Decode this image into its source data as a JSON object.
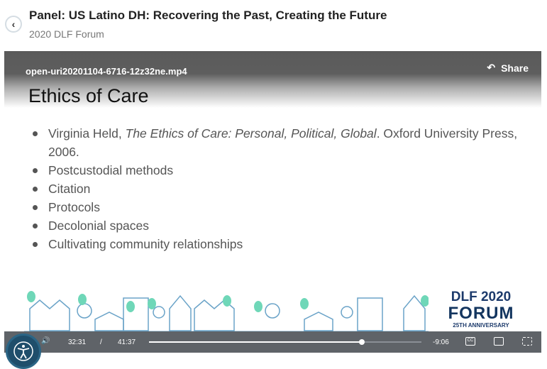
{
  "header": {
    "title": "Panel: US Latino DH: Recovering the Past, Creating the Future",
    "subtitle": "2020 DLF Forum",
    "back_icon": "chevron-left-icon"
  },
  "video": {
    "filename": "open-uri20201104-6716-12z32ne.mp4",
    "share_label": "Share",
    "slide": {
      "title": "Ethics of Care",
      "bullets": [
        {
          "pre": "Virginia Held, ",
          "italic": "The Ethics of Care: Personal, Political, Global",
          "post": ". Oxford University Press, 2006."
        },
        {
          "pre": "Postcustodial methods"
        },
        {
          "pre": "Citation"
        },
        {
          "pre": "Protocols"
        },
        {
          "pre": "Decolonial spaces"
        },
        {
          "pre": "Cultivating community relationships"
        }
      ],
      "logo": {
        "line1": "DLF 2020",
        "line2": "FORUM",
        "line3": "25TH ANNIVERSARY"
      }
    },
    "controls": {
      "current_time": "32:31",
      "separator": "/",
      "duration": "41:37",
      "remaining": "-9:06",
      "progress_percent": 78.1,
      "cc_label": "CC"
    }
  },
  "colors": {
    "control_bar": "#5f6368",
    "accessibility_button": "#1f4e6b",
    "logo_navy": "#13355f"
  }
}
